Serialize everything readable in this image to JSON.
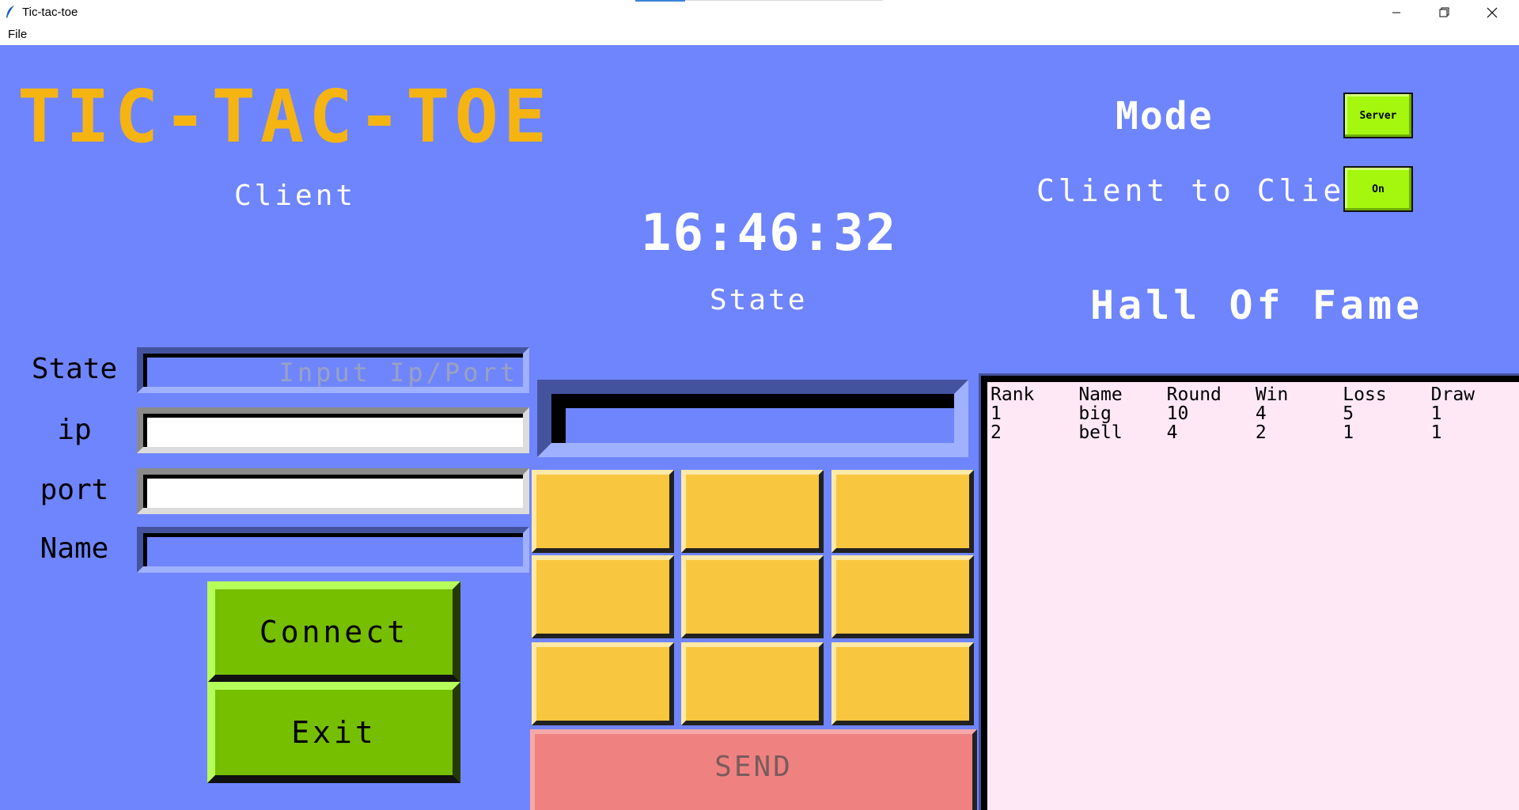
{
  "window": {
    "title": "Tic-tac-toe",
    "controls": [
      "minimize",
      "restore",
      "close"
    ]
  },
  "menu": {
    "file": "File"
  },
  "header": {
    "title": "TIC-TAC-TOE",
    "subtitle": "Client",
    "mode_label": "Mode",
    "mode_button": "Server",
    "c2c_label": "Client to Client",
    "c2c_button": "On"
  },
  "clock": "16:46:32",
  "form": {
    "state_label": "State",
    "state_placeholder": "Input Ip/Port",
    "ip_label": "ip",
    "ip_value": "",
    "port_label": "port",
    "port_value": "",
    "name_label": "Name",
    "name_value": "",
    "connect_button": "Connect",
    "exit_button": "Exit"
  },
  "game": {
    "state_label": "State",
    "state_value": "",
    "cells": [
      "",
      "",
      "",
      "",
      "",
      "",
      "",
      "",
      ""
    ],
    "send_button": "SEND"
  },
  "hall_of_fame": {
    "title": "Hall Of Fame",
    "columns": [
      "Rank",
      "Name",
      "Round",
      "Win",
      "Loss",
      "Draw"
    ],
    "rows": [
      [
        "1",
        "big",
        "10",
        "4",
        "5",
        "1"
      ],
      [
        "2",
        "bell",
        "4",
        "2",
        "1",
        "1"
      ]
    ]
  },
  "colors": {
    "background": "#6f85fe",
    "title": "#f5b412",
    "green_button": "#76be00",
    "toggle_button": "#a4f70d",
    "cell": "#f9c63f",
    "send": "#f08181",
    "table_bg": "#ffe8f6"
  }
}
